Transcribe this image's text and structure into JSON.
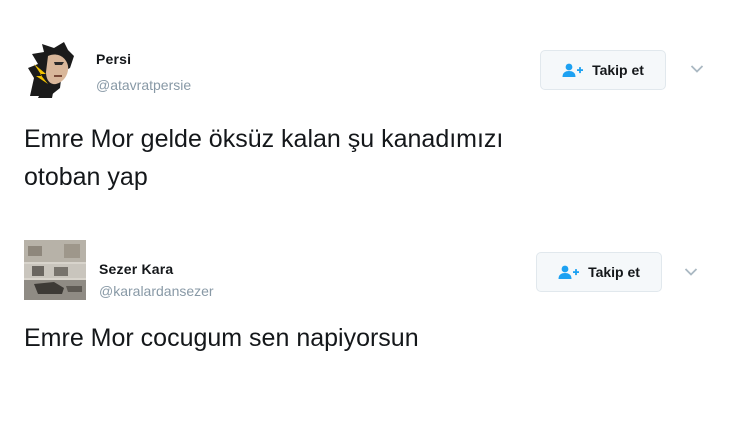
{
  "colors": {
    "name_text": "#14171a",
    "handle_text": "#8899a6",
    "button_bg": "#f5f8fa",
    "button_border": "#e1e8ed",
    "follow_icon": "#1da1f2",
    "chevron": "#aab8c2"
  },
  "tweets": [
    {
      "display_name": "Persi",
      "handle": "@atavratpersie",
      "follow_label": "Takip et",
      "follow_icon": "add-user-icon",
      "menu_icon": "chevron-down-icon",
      "avatar": "illustrated-face-avatar",
      "text": "Emre Mor gelde öksüz kalan şu kanadımızı\notoban yap"
    },
    {
      "display_name": "Sezer Kara",
      "handle": "@karalardansezer",
      "follow_label": "Takip et",
      "follow_icon": "add-user-icon",
      "menu_icon": "chevron-down-icon",
      "avatar": "street-photo-avatar",
      "text": "Emre Mor cocugum sen napiyorsun"
    }
  ]
}
